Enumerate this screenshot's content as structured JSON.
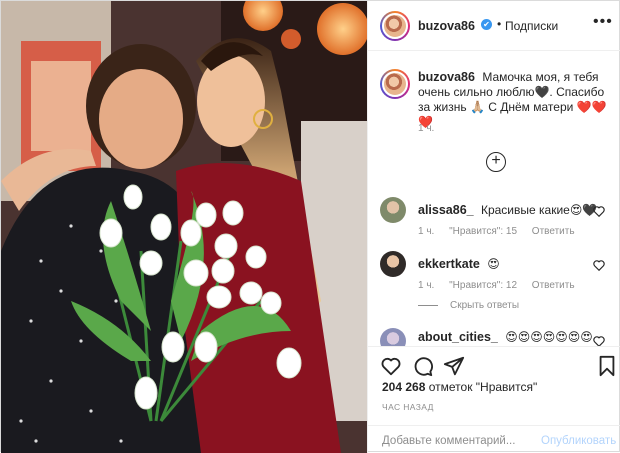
{
  "header": {
    "username": "buzova86",
    "verified_mark": "✔",
    "separator": "•",
    "follow_label": "Подписки",
    "more_label": "•••"
  },
  "caption": {
    "username": "buzova86",
    "text": "Мамочка моя, я тебя очень сильно люблю🖤. Спасибо за жизнь 🙏🏼 С Днём матери ❤️❤️❤️",
    "time": "1 ч."
  },
  "load_more_label": "+",
  "comments": [
    {
      "username": "alissa86_",
      "text": "Красивые какие😍🖤",
      "time": "1 ч.",
      "likes": "\"Нравится\": 15",
      "reply": "Ответить"
    },
    {
      "username": "ekkertkate",
      "text": "😍",
      "time": "1 ч.",
      "likes": "\"Нравится\": 12",
      "reply": "Ответить"
    },
    {
      "username": "about_cities_",
      "text": "😍😍😍😍😍😍😍"
    }
  ],
  "hide_replies_label": "Скрыть ответы",
  "actions": {
    "likes_count": "204 268",
    "likes_suffix": "отметок \"Нравится\"",
    "time_ago": "ЧАС НАЗАД",
    "icons": [
      "heart-icon",
      "comment-icon",
      "share-icon",
      "bookmark-icon"
    ]
  },
  "add_comment": {
    "placeholder": "Добавьте комментарий...",
    "publish_label": "Опубликовать"
  },
  "colors": {
    "link_blue": "#3897f0",
    "muted": "#8e8e8e",
    "text": "#262626",
    "publish_disabled": "#b3d4fc"
  }
}
